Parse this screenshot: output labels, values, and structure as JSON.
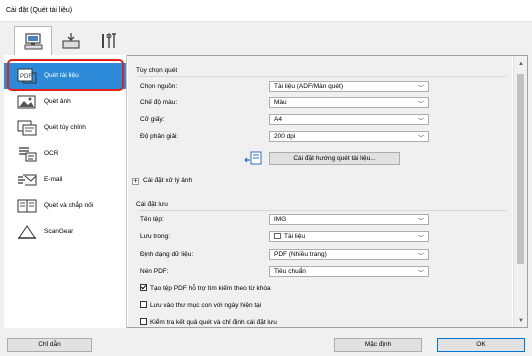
{
  "window": {
    "title": "Cài đặt (Quét tài liệu)"
  },
  "top_tabs": [
    {
      "icon": "scan-from-computer-icon",
      "active": true
    },
    {
      "icon": "scan-from-panel-icon",
      "active": false
    },
    {
      "icon": "general-settings-tools-icon",
      "active": false
    }
  ],
  "sidebar": {
    "items": [
      {
        "label": "Quét tài liệu",
        "icon": "document-scan-icon",
        "selected": true
      },
      {
        "label": "Quét ảnh",
        "icon": "photo-scan-icon",
        "selected": false
      },
      {
        "label": "Quét tùy chỉnh",
        "icon": "custom-scan-icon",
        "selected": false
      },
      {
        "label": "OCR",
        "icon": "ocr-icon",
        "selected": false
      },
      {
        "label": "E-mail",
        "icon": "email-icon",
        "selected": false
      },
      {
        "label": "Quét và chắp nối",
        "icon": "stitch-scan-icon",
        "selected": false
      },
      {
        "label": "ScanGear",
        "icon": "scangear-icon",
        "selected": false
      }
    ]
  },
  "scan_options": {
    "heading": "Tùy chọn quét",
    "source": {
      "label": "Chọn nguồn:",
      "value": "Tài liệu (ADF/Màn quét)"
    },
    "color_mode": {
      "label": "Chế độ màu:",
      "value": "Màu"
    },
    "paper_size": {
      "label": "Cỡ giấy:",
      "value": "A4"
    },
    "resolution": {
      "label": "Độ phân giải:",
      "value": "200 dpi"
    },
    "orientation_button": "Cài đặt hướng quét tài liệu...",
    "image_processing": "Cài đặt xử lý ảnh"
  },
  "save_settings": {
    "heading": "Cài đặt lưu",
    "file_name": {
      "label": "Tên tệp:",
      "value": "IMG"
    },
    "save_in": {
      "label": "Lưu trong:",
      "value": "Tài liệu"
    },
    "data_format": {
      "label": "Định dạng dữ liệu:",
      "value": "PDF (Nhiều trang)"
    },
    "pdf_compression": {
      "label": "Nén PDF:",
      "value": "Tiêu chuẩn"
    },
    "checkboxes": [
      {
        "label": "Tạo tệp PDF hỗ trợ tìm kiếm theo từ khóa",
        "checked": true
      },
      {
        "label": "Lưu vào thư mục con với ngày hiện tại",
        "checked": false
      },
      {
        "label": "Kiểm tra kết quả quét và chỉ định cài đặt lưu",
        "checked": false
      }
    ]
  },
  "footer": {
    "instructions": "Chỉ dẫn",
    "defaults": "Mặc định",
    "ok": "OK"
  },
  "colors": {
    "selection": "#2c8ad8",
    "highlight_box": "#e2201c"
  }
}
